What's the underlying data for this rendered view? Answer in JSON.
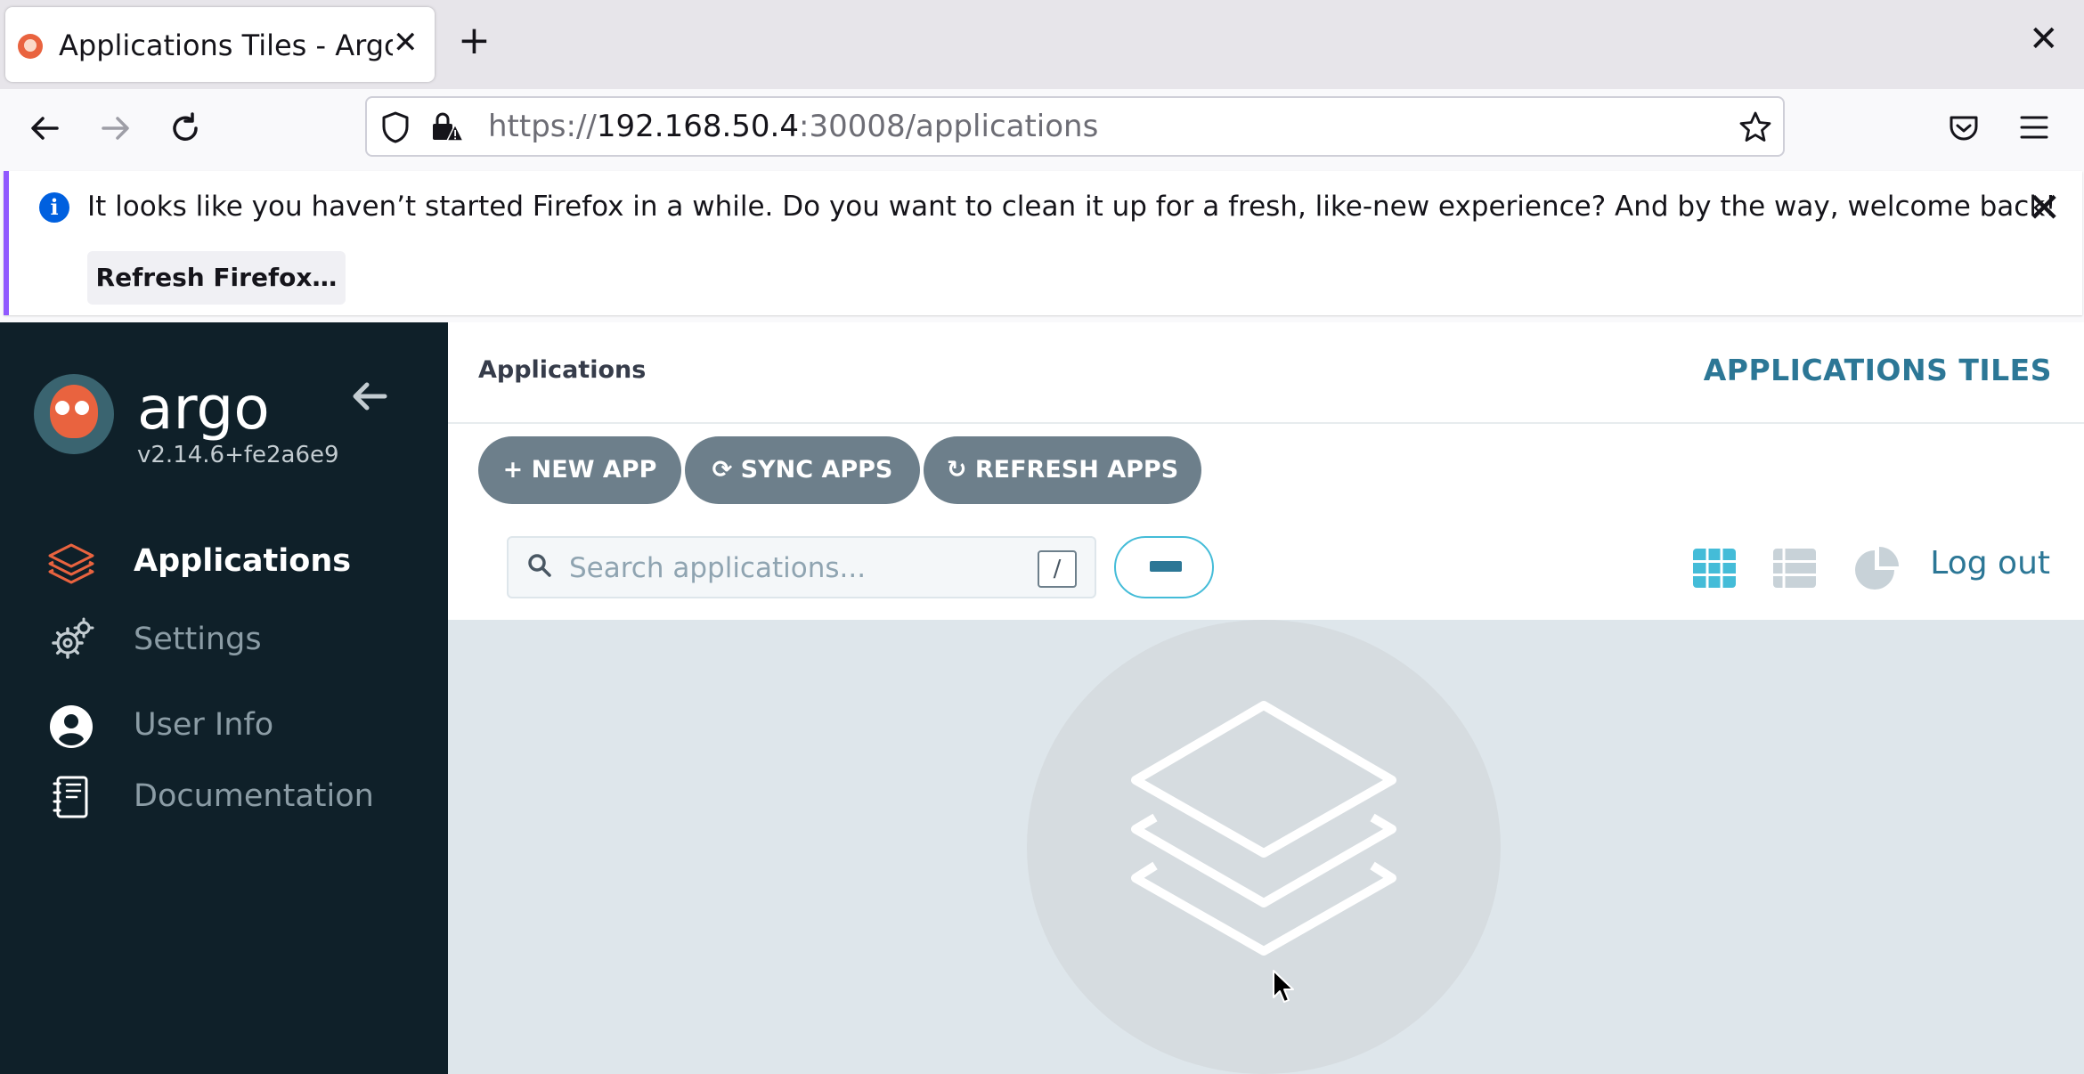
{
  "browser": {
    "tab_title": "Applications Tiles - Argo CD",
    "tab_close": "✕",
    "new_tab": "+",
    "window_close": "✕",
    "url_scheme": "https://",
    "url_host": "192.168.50.4",
    "url_rest": ":30008/applications"
  },
  "notification": {
    "message": "It looks like you haven’t started Firefox in a while. Do you want to clean it up for a fresh, like-new experience? And by the way, welcome back!",
    "button_label": "Refresh Firefox…",
    "close": "✕"
  },
  "sidebar": {
    "brand": "argo",
    "version": "v2.14.6+fe2a6e9",
    "items": [
      {
        "label": "Applications",
        "icon": "layers-icon",
        "active": true
      },
      {
        "label": "Settings",
        "icon": "gears-icon",
        "active": false
      },
      {
        "label": "User Info",
        "icon": "user-circle-icon",
        "active": false
      },
      {
        "label": "Documentation",
        "icon": "book-icon",
        "active": false
      }
    ]
  },
  "main": {
    "breadcrumb": "Applications",
    "title": "APPLICATIONS TILES",
    "toolbar": {
      "new_app": "+ NEW APP",
      "sync_apps": "⟳ SYNC APPS",
      "refresh_apps": "↻ REFRESH APPS"
    },
    "search_placeholder": "Search applications...",
    "search_shortcut": "/",
    "logout": "Log out"
  },
  "colors": {
    "accent": "#2c7796",
    "sidebar_bg": "#0f2029",
    "argo_orange": "#e9633f",
    "button_gray": "#6d7f8b",
    "tile_view_active": "#44bcd8"
  }
}
